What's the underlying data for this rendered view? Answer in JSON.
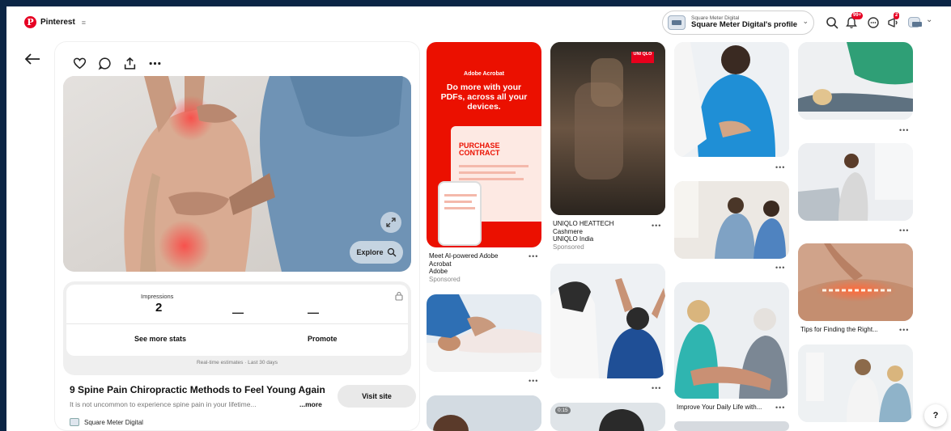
{
  "header": {
    "logo_text": "Pinterest",
    "menu_glyph": "≡",
    "profile_small": "Square Meter Digital",
    "profile_name": "Square Meter Digital's profile",
    "chevron": "⌄",
    "notif_badge": "99+",
    "msg_badge": "2"
  },
  "pin": {
    "explore_label": "Explore",
    "stats": {
      "impressions_label": "Impressions",
      "impressions_value": "2",
      "dash_1": "—",
      "dash_2": "—",
      "see_more_stats": "See more stats",
      "promote": "Promote",
      "estimates_note": "Real-time estimates · Last 30 days"
    },
    "title": "9 Spine Pain Chiropractic Methods to Feel Young Again",
    "description": "It is not uncommon to experience spine pain in your lifetime...",
    "more_label": "...more",
    "visit_label": "Visit site",
    "author": "Square Meter Digital"
  },
  "feed": {
    "adobe": {
      "brand": "Adobe Acrobat",
      "headline": "Do more with your PDFs, across all your devices.",
      "doc_text": "PURCHASE CONTRACT",
      "caption": "Meet AI-powered Adobe Acrobat",
      "advertiser": "Adobe",
      "sponsored": "Sponsored"
    },
    "uniqlo": {
      "logo": "UNI QLO",
      "caption_1": "UNIQLO HEATTECH",
      "caption_2": "Cashmere",
      "advertiser": "UNIQLO India",
      "sponsored": "Sponsored"
    },
    "col3_caption": "Improve Your Daily Life with...",
    "col4_caption": "Tips for Finding the Right...",
    "video_time": "0:15",
    "dots": "•••"
  },
  "help_label": "?",
  "colors": {
    "brand_red": "#e60023",
    "frame": "#0b2545",
    "adobe_red": "#eb1000"
  }
}
